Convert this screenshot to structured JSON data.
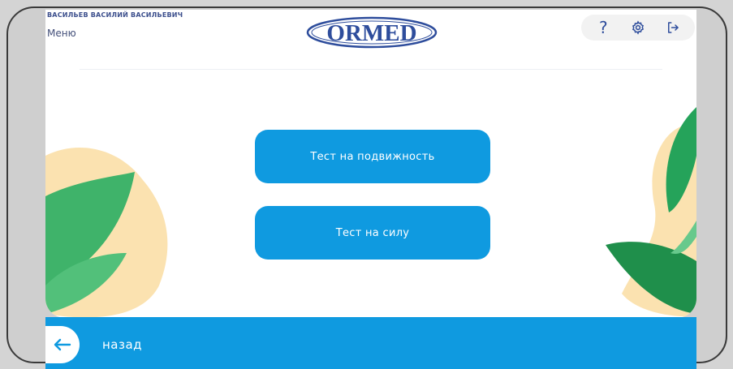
{
  "header": {
    "user_name": "ВАСИЛЬЕВ ВАСИЛИЙ ВАСИЛЬЕВИЧ",
    "menu_label": "Меню",
    "logo_text": "ORMED",
    "help_label": "?"
  },
  "main": {
    "buttons": [
      {
        "label": "Тест на подвижность"
      },
      {
        "label": "Тест на силу"
      }
    ]
  },
  "footer": {
    "back_label": "назад"
  },
  "colors": {
    "accent": "#0f9ae0",
    "brand": "#2e4d9c",
    "leaf_green": "#2fae5f",
    "leaf_yellow": "#f9d89a"
  },
  "icons": [
    "help-icon",
    "gear-icon",
    "logout-icon",
    "arrow-left-icon"
  ]
}
